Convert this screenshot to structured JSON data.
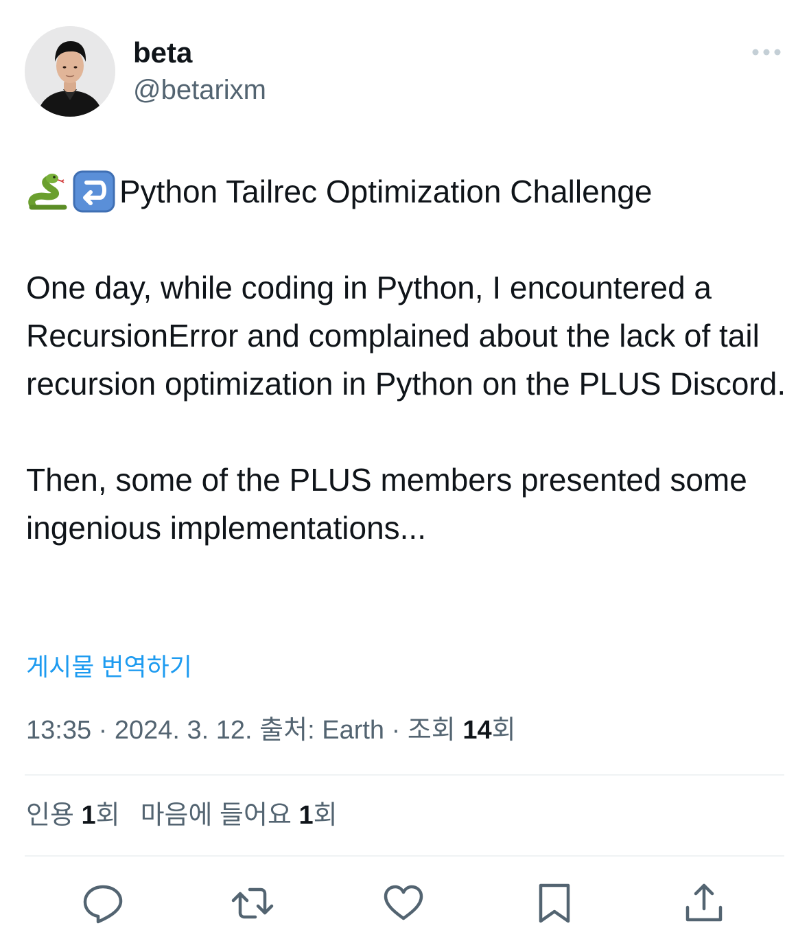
{
  "author": {
    "display_name": "beta",
    "handle": "@betarixm"
  },
  "tweet": {
    "title": "Python Tailrec Optimization Challenge",
    "title_icons": [
      "snake-emoji",
      "leftwards-arrow-with-hook-emoji"
    ],
    "paragraph_1": "One day, while coding in Python, I encountered a RecursionError and complained about the lack of tail recursion optimization in Python on the PLUS Discord.",
    "paragraph_2": "Then, some of the PLUS members presented some ingenious implementations..."
  },
  "translate_link": "게시물 번역하기",
  "meta": {
    "time": "13:35",
    "separator": "·",
    "date": "2024. 3. 12.",
    "source_label": "출처:",
    "source": "Earth",
    "views_label": "조회",
    "views_count": "14",
    "views_unit": "회"
  },
  "stats": {
    "quotes_label": "인용",
    "quotes_count": "1",
    "quotes_unit": "회",
    "likes_label": "마음에 들어요",
    "likes_count": "1",
    "likes_unit": "회"
  },
  "actions": [
    "reply-icon",
    "retweet-icon",
    "like-icon",
    "bookmark-icon",
    "share-icon"
  ],
  "colors": {
    "text": "#0f1419",
    "secondary": "#536471",
    "link": "#1d9bf0",
    "divider": "#eff3f4"
  }
}
